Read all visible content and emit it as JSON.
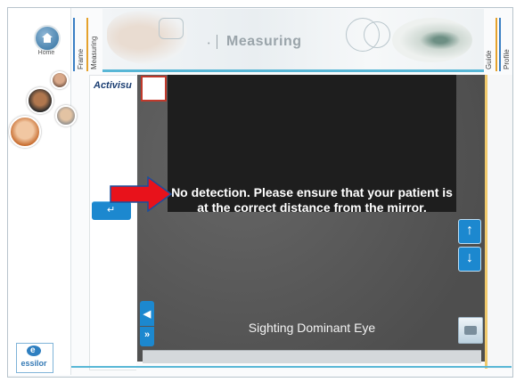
{
  "sidebar": {
    "home_label": "Home",
    "brand": "essilor"
  },
  "tabs": {
    "frame": "Frame",
    "measuring": "Measuring",
    "guide": "Guide",
    "profile": "Profile"
  },
  "header": {
    "title": "Measuring"
  },
  "workspace": {
    "brand": "Activisu",
    "message": "No detection. Please ensure that your patient is at the correct distance from the mirror.",
    "caption": "Sighting Dominant Eye"
  },
  "colors": {
    "accent_blue": "#1c88cf",
    "annotation_red": "#e8121b",
    "header_underline": "#59b7d6",
    "tab_orange": "#e5a22c"
  },
  "icons": {
    "home": "home-icon",
    "back": "back-arrow-icon",
    "up": "arrow-up-icon",
    "down": "arrow-down-icon",
    "camera": "camera-icon",
    "expand": "double-chevron-icon"
  }
}
